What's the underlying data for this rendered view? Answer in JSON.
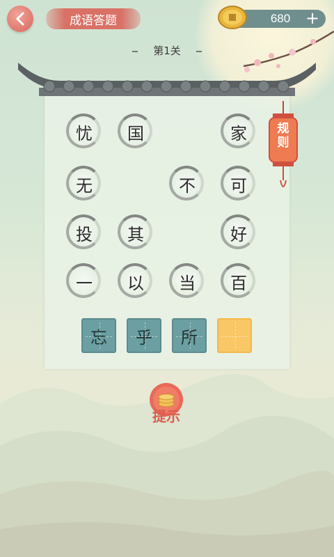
{
  "header": {
    "title": "成语答题",
    "coins": "680",
    "add": "+"
  },
  "level": "第1关",
  "rules": "规则",
  "grid": [
    {
      "char": "忧",
      "col": 0,
      "row": 0
    },
    {
      "char": "国",
      "col": 1,
      "row": 0
    },
    {
      "char": "家",
      "col": 3,
      "row": 0
    },
    {
      "char": "无",
      "col": 0,
      "row": 1
    },
    {
      "char": "不",
      "col": 2,
      "row": 1
    },
    {
      "char": "可",
      "col": 3,
      "row": 1
    },
    {
      "char": "投",
      "col": 0,
      "row": 2
    },
    {
      "char": "其",
      "col": 1,
      "row": 2
    },
    {
      "char": "好",
      "col": 3,
      "row": 2
    },
    {
      "char": "一",
      "col": 0,
      "row": 3
    },
    {
      "char": "以",
      "col": 1,
      "row": 3
    },
    {
      "char": "当",
      "col": 2,
      "row": 3
    },
    {
      "char": "百",
      "col": 3,
      "row": 3
    }
  ],
  "options": [
    "忘",
    "乎",
    "所",
    ""
  ],
  "hint": "提示",
  "colors": {
    "accent": "#d97166",
    "option": "#6c9fa2",
    "empty_option": "#f9c766"
  }
}
